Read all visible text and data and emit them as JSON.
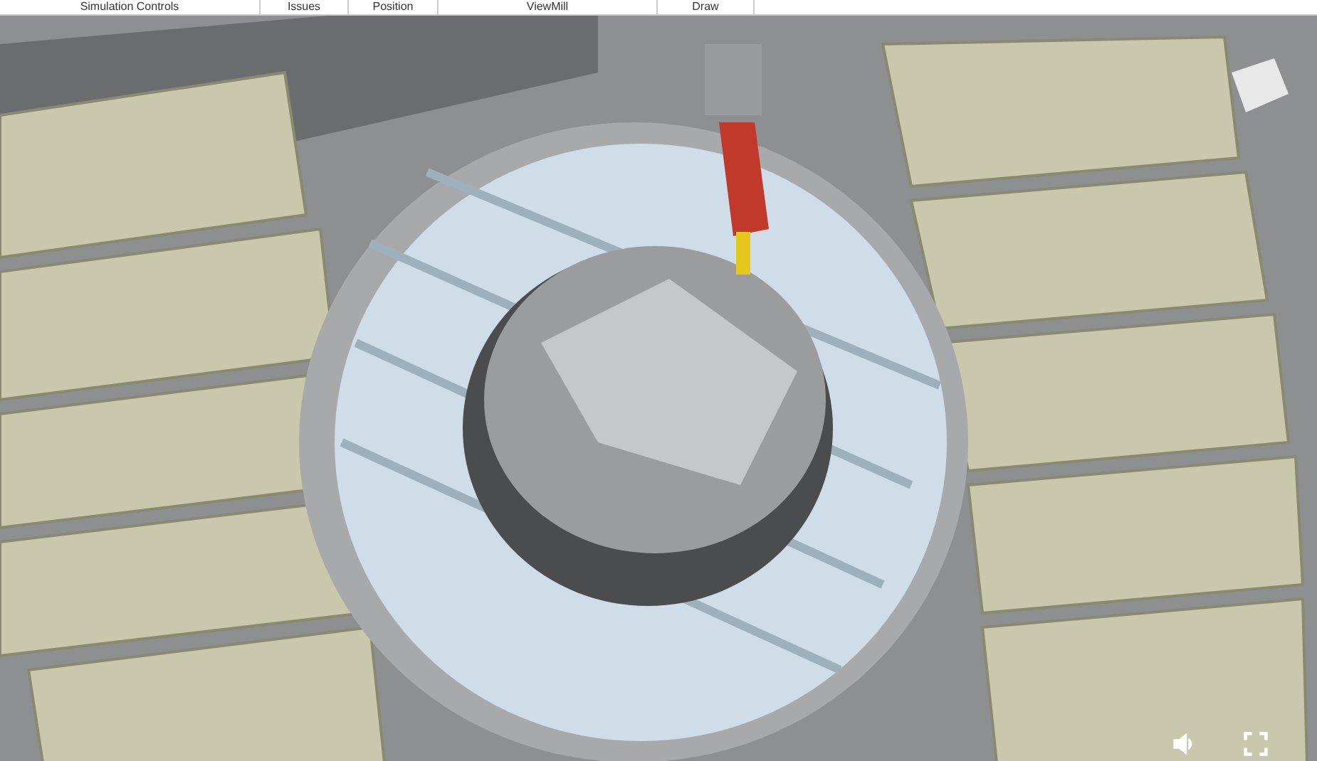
{
  "ribbon": {
    "groups": [
      {
        "label": "Simulation Controls"
      },
      {
        "label": "Issues"
      },
      {
        "label": "Position"
      },
      {
        "label": "ViewMill"
      },
      {
        "label": "Draw"
      }
    ]
  }
}
